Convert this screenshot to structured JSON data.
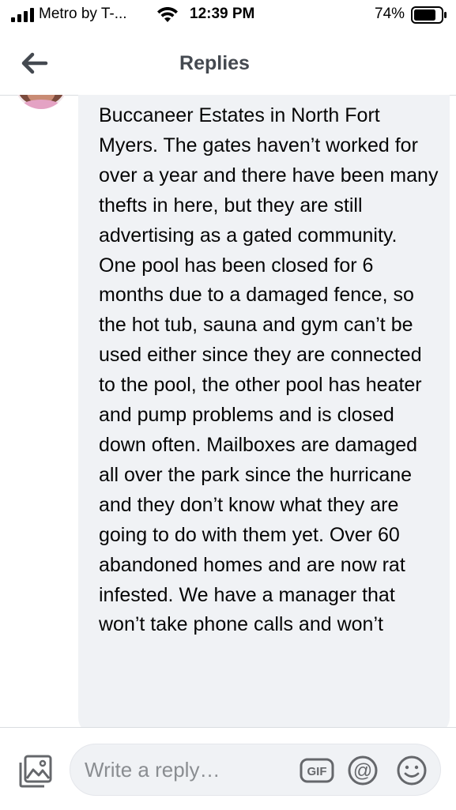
{
  "status_bar": {
    "carrier": "Metro by T-...",
    "time": "12:39 PM",
    "battery": "74%"
  },
  "header": {
    "title": "Replies"
  },
  "comment": {
    "text": "Buccaneer Estates in North Fort Myers. The gates haven’t worked for over a year and there have been many thefts in here, but they are still advertising as a gated community. One pool has been closed for 6 months due to a damaged fence, so the hot tub, sauna and gym can’t be used either since they are connected to the pool, the other pool has heater and pump problems and is closed down often. Mailboxes are damaged all over the park since the hurricane and they don’t know what they are going to do with them yet. Over 60 abandoned homes and are now rat infested.  We have a manager that won’t take phone calls and won’t"
  },
  "reply_bar": {
    "placeholder": "Write a reply…",
    "gif_label": "GIF"
  },
  "colors": {
    "bubble": "#f0f2f5",
    "header_title": "#444950",
    "placeholder": "#8a8d91",
    "icon": "#65676b"
  },
  "icons": [
    "signal-icon",
    "wifi-icon",
    "battery-icon",
    "back-arrow-icon",
    "photo-icon",
    "gif-icon",
    "at-icon",
    "emoji-icon"
  ]
}
